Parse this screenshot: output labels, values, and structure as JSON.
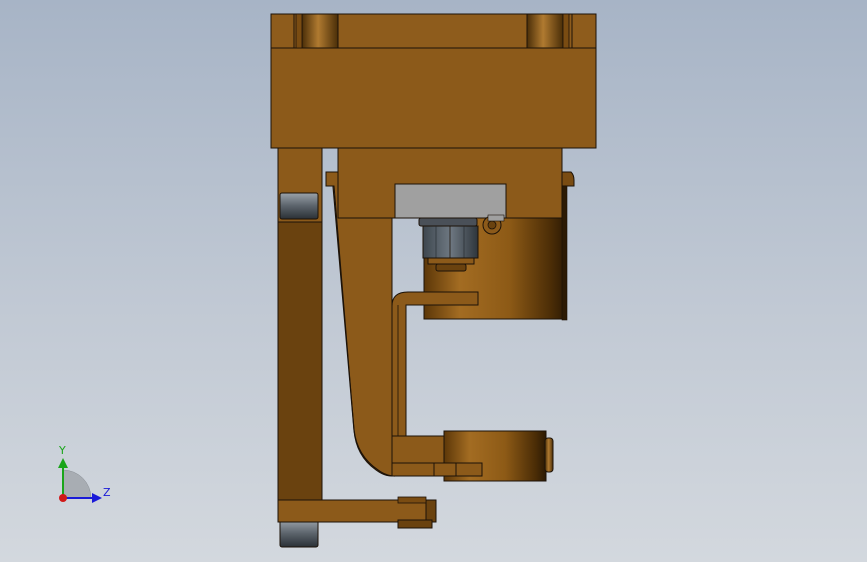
{
  "triad": {
    "y_label": "Y",
    "z_label": "Z",
    "colors": {
      "y": "#1aa51a",
      "z": "#1a1ad8",
      "x": "#d01818"
    }
  },
  "model": {
    "colors": {
      "bronze": "#8c5a1a",
      "bronze_dark": "#6a420f",
      "bronze_light": "#a06a24",
      "grey_block": "#a0a0a0",
      "nut": "#55606a",
      "edge": "#1c1208"
    }
  }
}
